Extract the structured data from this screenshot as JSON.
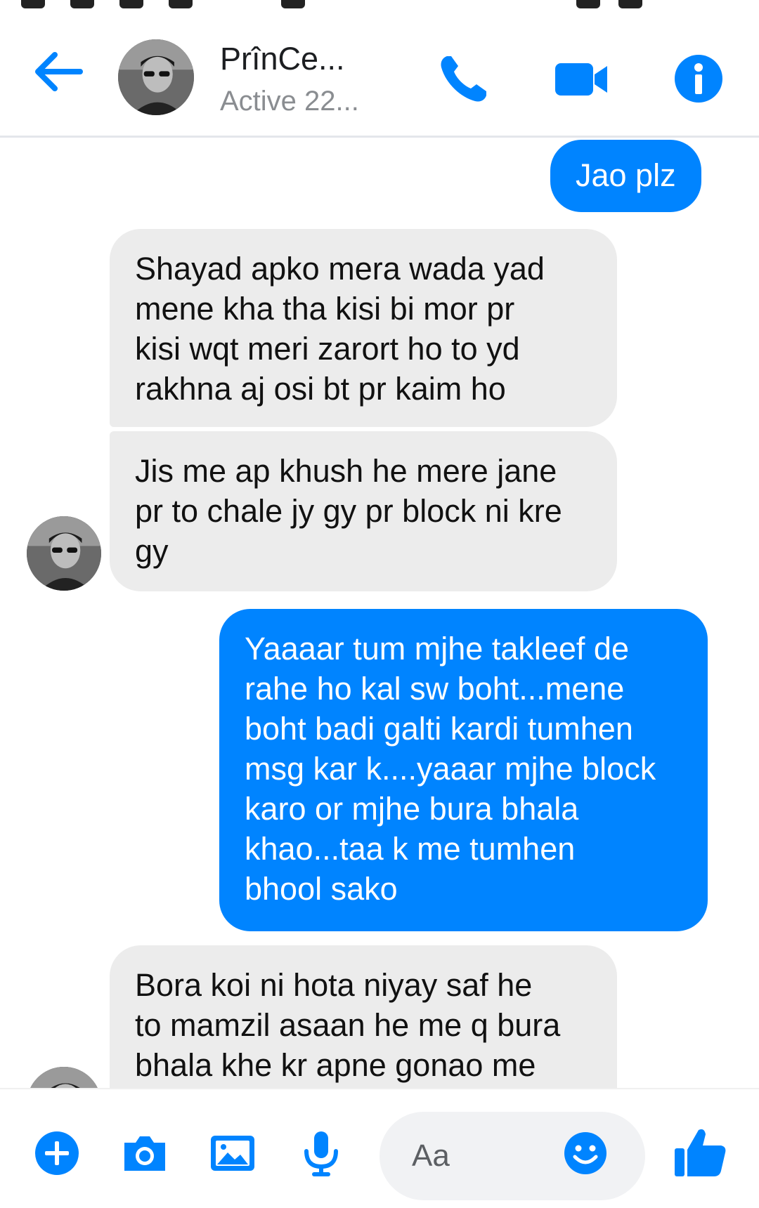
{
  "header": {
    "contact_name": "PrînCe...",
    "contact_status": "Active 22..."
  },
  "messages": [
    {
      "direction": "outgoing",
      "lines": [
        "Jao plz"
      ]
    },
    {
      "direction": "incoming",
      "lines": [
        "Shayad apko mera wada yad",
        "mene kha tha kisi bi mor pr",
        "kisi wqt meri zarort ho to yd",
        "rakhna aj osi bt pr kaim ho"
      ]
    },
    {
      "direction": "incoming",
      "lines": [
        "Jis me ap khush he mere jane",
        "pr to chale jy gy pr block ni kre",
        "gy"
      ]
    },
    {
      "direction": "outgoing",
      "lines": [
        "Yaaaar tum mjhe takleef de",
        "rahe ho kal sw boht...mene",
        "boht badi galti kardi tumhen",
        "msg kar k....yaaar mjhe block",
        "karo or mjhe bura bhala",
        "khao...taa k me tumhen",
        "bhool sako"
      ]
    },
    {
      "direction": "incoming",
      "lines": [
        "Bora koi ni hota niyay saf he",
        "to mamzil asaan he me q bura",
        "bhala khe kr apne gonao me"
      ]
    }
  ],
  "composer": {
    "placeholder": "Aa"
  },
  "colors": {
    "accent": "#0084ff",
    "incoming_bubble": "#ececec",
    "muted_text": "#8a8d91"
  },
  "icons": {
    "back": "arrow-left-icon",
    "call": "phone-icon",
    "video": "video-camera-icon",
    "info": "info-icon",
    "plus": "plus-icon",
    "camera": "camera-icon",
    "gallery": "image-icon",
    "mic": "microphone-icon",
    "emoji": "emoji-icon",
    "like": "thumbs-up-icon"
  }
}
